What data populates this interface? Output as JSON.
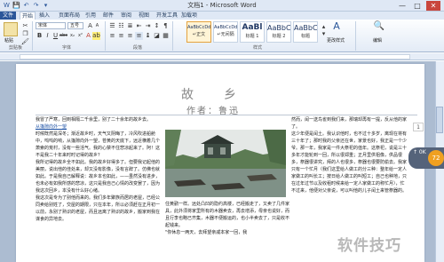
{
  "window": {
    "title": "文档1 - Microsoft Word",
    "min_glyph": "—",
    "max_glyph": "□",
    "close_glyph": "✕"
  },
  "quick_access": [
    "W",
    "💾",
    "↶",
    "↷",
    "▾"
  ],
  "ribbon_tabs": [
    "文件",
    "开始",
    "插入",
    "页面布局",
    "引用",
    "邮件",
    "审阅",
    "视图",
    "开发工具",
    "加载项"
  ],
  "ribbon": {
    "clipboard_group": "剪贴板",
    "paste_label": "粘贴",
    "font_group": "字体",
    "font_name": "宋体",
    "font_size": "五号",
    "format_buttons": [
      "B",
      "I",
      "U",
      "abc",
      "x₂",
      "x²",
      "A"
    ],
    "paragraph_group": "段落",
    "styles_group": "样式",
    "styles": [
      {
        "sample": "AaBbCcDd",
        "name": "↵正文"
      },
      {
        "sample": "AaBbCcDd",
        "name": "↵无间隔"
      },
      {
        "sample": "AaBl",
        "name": "标题 1"
      },
      {
        "sample": "AaBbC",
        "name": "标题 2"
      },
      {
        "sample": "AaBbC",
        "name": "标题"
      }
    ],
    "change_styles_label": "更改样式",
    "edit_label": "编辑"
  },
  "document": {
    "heading": "故　乡",
    "author": "作者：鲁迅",
    "col1": [
      "我冒了严寒，回到相隔二千余里，别了二十余年的故乡去。",
      "时候既然是深冬；渐近故乡时，天气又阴晦了，冷风吹进船舱中，呜呜的响，从篷隙向外一望，苍黄的天底下，远近横着几个萧索的荒村，没有一些活气。我的心禁不住悲凉起来了。阿！这不是我二十年来时时记得的故乡？",
      "我所记得的故乡全不如此。我的故乡好得多了。但要我记起他的美丽，说出他的佳处来，却又没有影像，没有言辞了。仿佛也就如此。于是我自己解释说：故乡本也如此，——虽然没有进步，也未必有如我所感的悲凉，这只是我自己心情的改变罢了，因为我这次回乡，本没有什么好心绪。",
      "我这次是专为了别他而来的。我们多年聚族而居的老屋，已经公同卖给别姓了，交屋的期限，只在本年，所以必须赶在正月初一以前，永别了熟识的老屋，而且远离了熟识的故乡，搬家到我在谋食的异地去。"
    ],
    "col1_link": "从篷隙向外一望",
    "col2": "住黄鹂一样。远处凸凹的隐约高楼，已经搬走了，又卖了几件家具，此外须将家里所有的木器卖去，再去增添，母亲也说好，而且行李也略已齐集，木器不便搬运的，也小半卖去了，只是收不起钱来。",
    "col2_tail": "\"你休息一两天，去拜望亲戚本家一回，我",
    "col3": [
      "然而，闰一送鸟雀到我们来，那瑞却再有一提，反从他的家了。",
      "这少年便是闰土。我认识他时，也不过十多岁，离现在将有三十年了；那时我的父亲还在世，家景也好，我正是一个少爷。那一年，我家是一件大祭祀的值年。这祭祀，说是三十多年才能轮到一回，所以很郑重；正月里供祖像，供品很多，祭器很讲究，拜的人也很多，祭器也很要防偷去。我家只有一个忙月（我们这里给人做工的分三种：整年给一定人家做工的叫长工；按日给人做工的叫短工；自己也种地，只在过年过节以及收租时候来给一定人家做工的称忙月），忙不过来，他便对父亲说，可以叫他的儿子闰土来管祭器的。"
    ],
    "page_marker": "1",
    "side_widget_value": "72",
    "side_widget_up": "↑ 0K"
  },
  "watermark": "软件技巧"
}
